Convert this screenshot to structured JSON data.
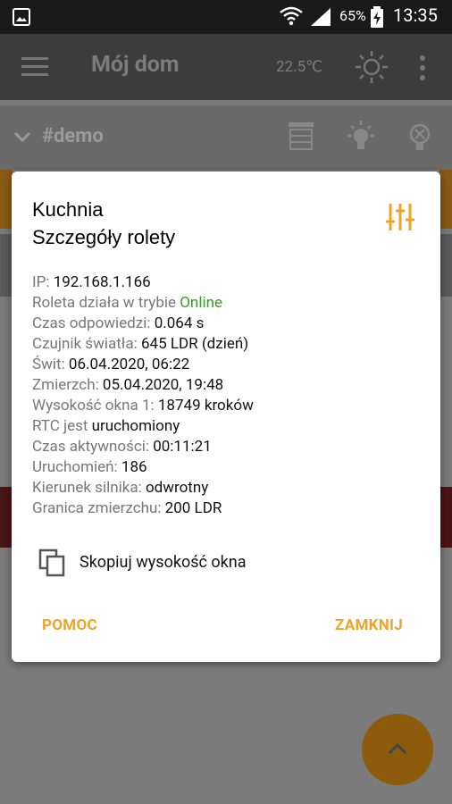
{
  "status_bar": {
    "battery_percent": "65%",
    "time": "13:35"
  },
  "toolbar": {
    "title": "Mój dom",
    "temperature": "22.5℃"
  },
  "group": {
    "name": "#demo"
  },
  "dialog": {
    "title_line1": "Kuchnia",
    "title_line2": "Szczegóły rolety",
    "details": [
      {
        "label": "IP: ",
        "value": "192.168.1.166"
      },
      {
        "label": "Roleta działa w trybie ",
        "value": "Online"
      },
      {
        "label": "Czas odpowiedzi: ",
        "value": "0.064 s"
      },
      {
        "label": "Czujnik światła: ",
        "value": "645 LDR (dzień)"
      },
      {
        "label": "Świt: ",
        "value": "06.04.2020, 06:22"
      },
      {
        "label": "Zmierzch: ",
        "value": "05.04.2020, 19:48"
      },
      {
        "label": "Wysokość okna 1: ",
        "value": "18749 kroków"
      },
      {
        "label": "RTC jest ",
        "value": "uruchomiony"
      },
      {
        "label": "Czas aktywności: ",
        "value": "00:11:21"
      },
      {
        "label": "Uruchomień: ",
        "value": "186"
      },
      {
        "label": "Kierunek silnika: ",
        "value": "odwrotny"
      },
      {
        "label": "Granica zmierzchu: ",
        "value": "200 LDR"
      }
    ],
    "copy_label": "Skopiuj wysokość okna",
    "help_button": "POMOC",
    "close_button": "ZAMKNIJ"
  },
  "colors": {
    "accent": "#f0a326",
    "online": "#3a9a28",
    "toolbar": "#3c3c3c",
    "status_bar": "#1a1a1a"
  }
}
